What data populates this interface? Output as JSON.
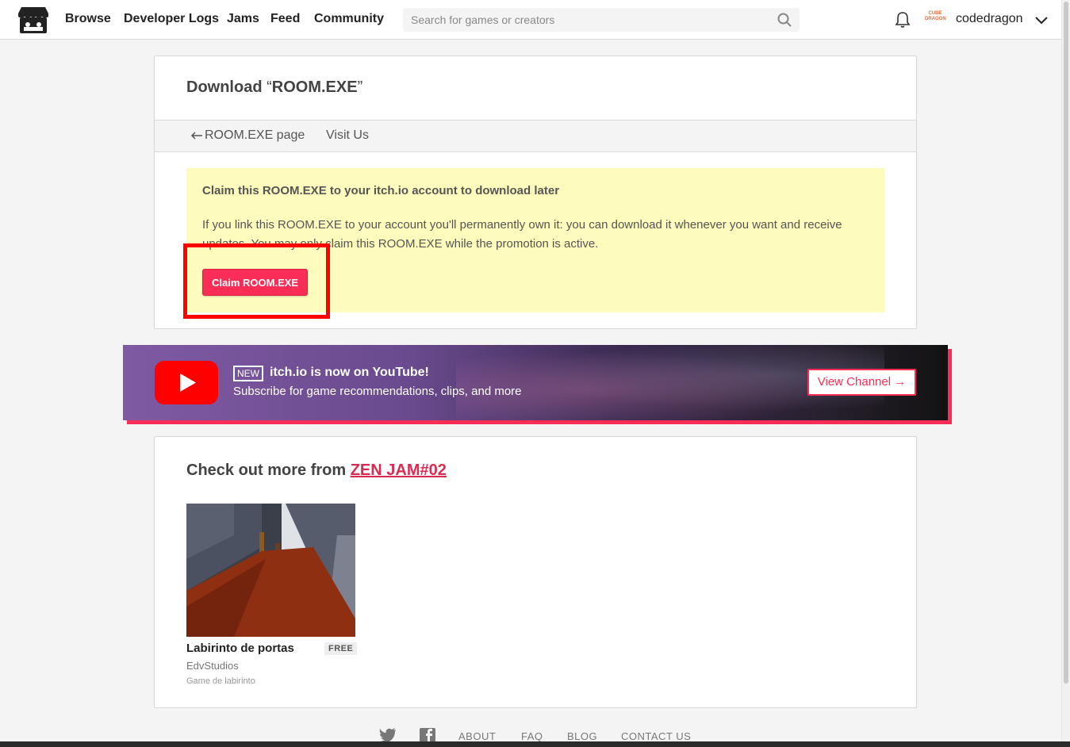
{
  "header": {
    "nav": [
      "Browse",
      "Developer Logs",
      "Jams",
      "Feed",
      "Community"
    ],
    "search_placeholder": "Search for games or creators",
    "avatar_text": "CUBE DRAGON",
    "username": "codedragon"
  },
  "download": {
    "title_prefix": "Download ",
    "open_quote": "“",
    "game_name": "ROOM.EXE",
    "close_quote": "”",
    "back_link": "ROOM.EXE page",
    "visit_link": "Visit Us",
    "claim_title": "Claim this ROOM.EXE to your itch.io account to download later",
    "claim_text": "If you link this ROOM.EXE to your account you'll permanently own it: you can download it whenever you want and receive updates. You may only claim this ROOM.EXE while the promotion is active.",
    "claim_button": "Claim ROOM.EXE"
  },
  "youtube": {
    "badge": "NEW",
    "title": "itch.io is now on YouTube!",
    "subtitle": "Subscribe for game recommendations, clips, and more",
    "button": "View Channel →"
  },
  "more": {
    "title_prefix": "Check out more from ",
    "jam_name": "ZEN JAM#02",
    "games": [
      {
        "title": "Labirinto de portas",
        "price": "FREE",
        "author": "EdvStudios",
        "description": "Game de labirinto"
      }
    ]
  },
  "footer": {
    "links": [
      "ABOUT",
      "FAQ",
      "BLOG",
      "CONTACT US"
    ]
  },
  "colors": {
    "accent": "#fa2d56",
    "promo_bg": "#fdfcbc",
    "highlight": "#ff0000"
  }
}
